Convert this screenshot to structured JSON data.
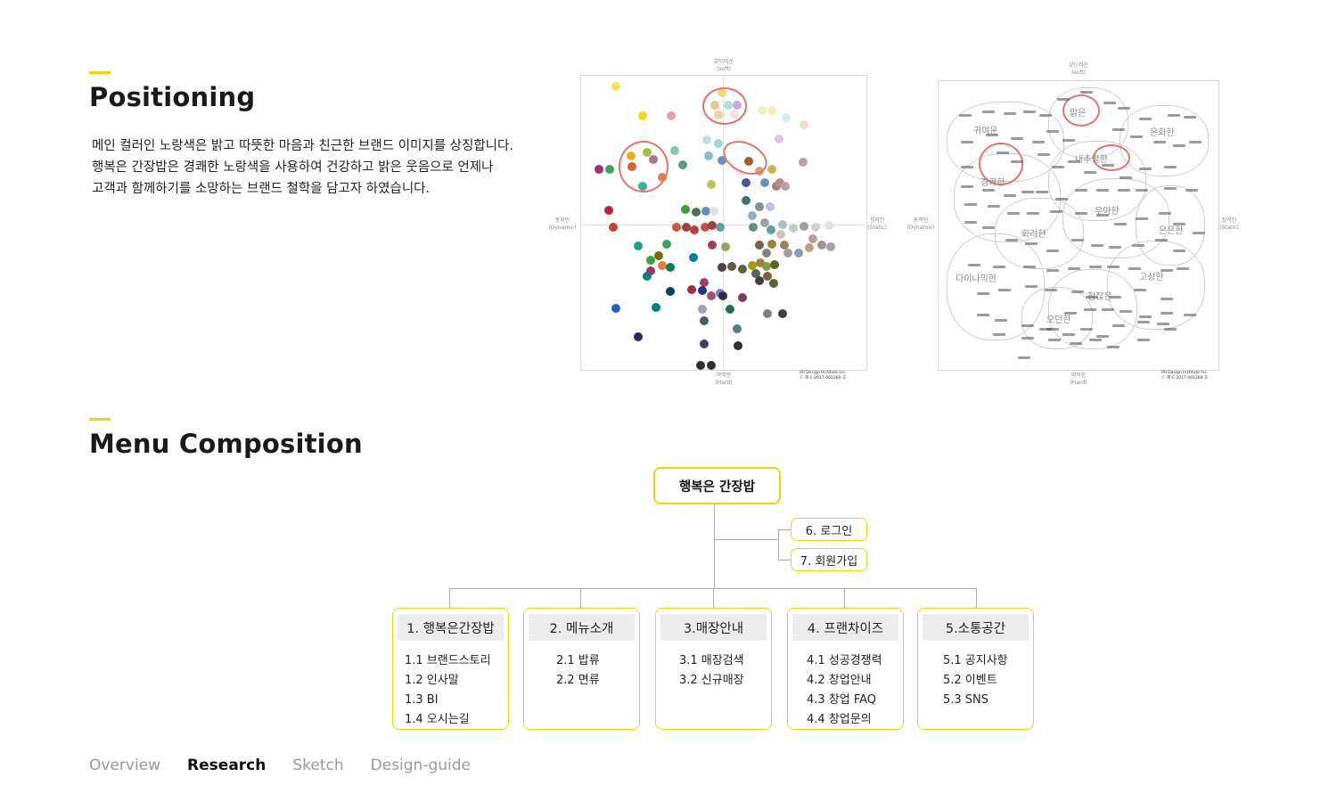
{
  "positioning": {
    "title": "Positioning",
    "description": [
      "메인 컬러인 노랑색은 밝고 따뜻한 마음과 친근한 브랜드 이미지를 상징합니다.",
      "행복은 간장밥은 경쾌한 노랑색을 사용하여 건강하고 밝은 웃음으로 언제나",
      "고객과 함께하기를 소망하는 브랜드 철학을 담고자 하였습니다."
    ],
    "color_map": {
      "axis_top": [
        "부드러운",
        "(soft)"
      ],
      "axis_bottom": [
        "딱딱한",
        "(Hard)"
      ],
      "axis_left": [
        "동적인",
        "(Dynamic)"
      ],
      "axis_right": [
        "정적인",
        "(Static)"
      ],
      "copyright": [
        "IRI Design Institute Inc.",
        "ⓒ 제 C-2017-001369 호"
      ]
    },
    "word_map": {
      "axis_top": [
        "부드러운",
        "(soft)"
      ],
      "axis_bottom": [
        "딱딱한",
        "(Hard)"
      ],
      "axis_left": [
        "동적인",
        "(Dynamic)"
      ],
      "axis_right": [
        "정적인",
        "(Static)"
      ],
      "copyright": [
        "IRI Design Institute Inc.",
        "ⓒ 제 C-2017-001369 호"
      ],
      "group_labels": [
        "귀여운",
        "맑은",
        "온화한",
        "내추럴한",
        "경쾌한",
        "우아한",
        "화려한",
        "은은한",
        "다이나믹한",
        "고상한",
        "점잖은",
        "오던한"
      ]
    }
  },
  "menu": {
    "title": "Menu Composition",
    "root": "행복은 간장밥",
    "side": [
      "6. 로그인",
      "7. 회원가입"
    ],
    "columns": [
      {
        "head": "1. 행복은간장밥",
        "items": [
          "1.1 브랜드스토리",
          "1.2 인사말",
          "1.3 BI",
          "1.4 오시는길"
        ]
      },
      {
        "head": "2. 메뉴소개",
        "items": [
          "2.1 밥류",
          "2.2 면류"
        ]
      },
      {
        "head": "3.매장안내",
        "items": [
          "3.1 매장검색",
          "3.2 신규매장"
        ]
      },
      {
        "head": "4. 프랜차이즈",
        "items": [
          "4.1 성공경쟁력",
          "4.2 창업안내",
          "4.3 창업 FAQ",
          "4.4 창업문의"
        ]
      },
      {
        "head": "5.소통공간",
        "items": [
          "5.1 공지사항",
          "5.2 이벤트",
          "5.3 SNS"
        ]
      }
    ]
  },
  "tabs": [
    {
      "label": "Overview",
      "active": false
    },
    {
      "label": "Research",
      "active": true
    },
    {
      "label": "Sketch",
      "active": false
    },
    {
      "label": "Design-guide",
      "active": false
    }
  ],
  "colors": {
    "accent": "#f2d20f",
    "ring": "#e5736c"
  }
}
